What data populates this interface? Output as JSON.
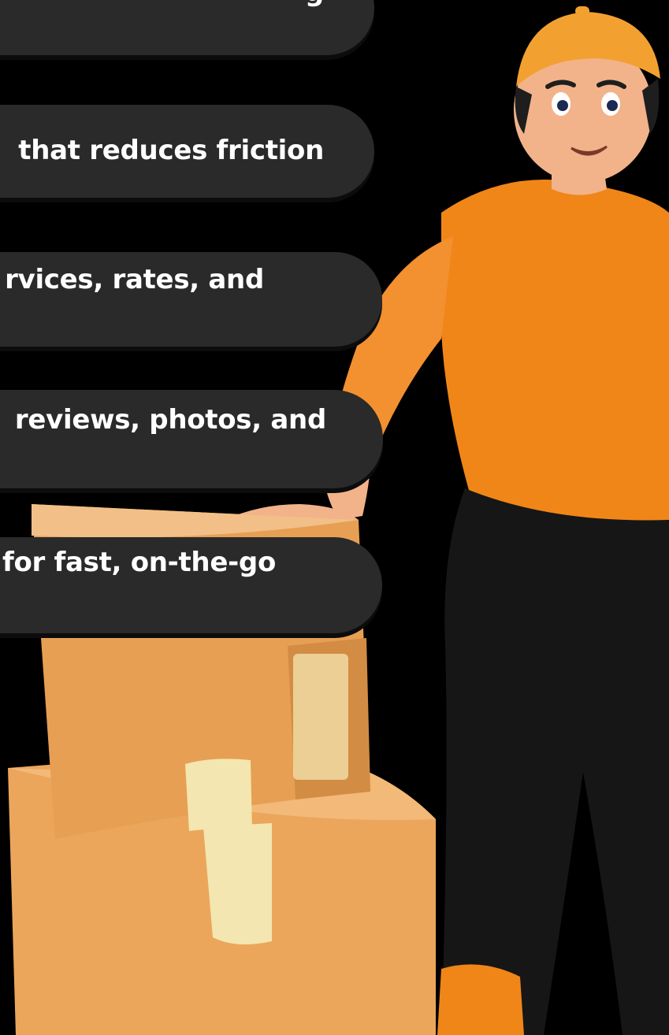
{
  "pills": [
    {
      "text": "g"
    },
    {
      "text": "that reduces friction"
    },
    {
      "text": "rvices, rates, and"
    },
    {
      "text": "reviews, photos, and"
    },
    {
      "text": "g for fast, on-the-go"
    }
  ],
  "illustration": {
    "subject": "delivery-courier-with-boxes",
    "colors": {
      "shirt": "#f38a1f",
      "pants": "#1a1a1a",
      "box": "#e8a35a",
      "tape": "#f3e6b0",
      "skin": "#f2b38a",
      "background": "#000000",
      "pill": "#2a2a2a"
    }
  }
}
